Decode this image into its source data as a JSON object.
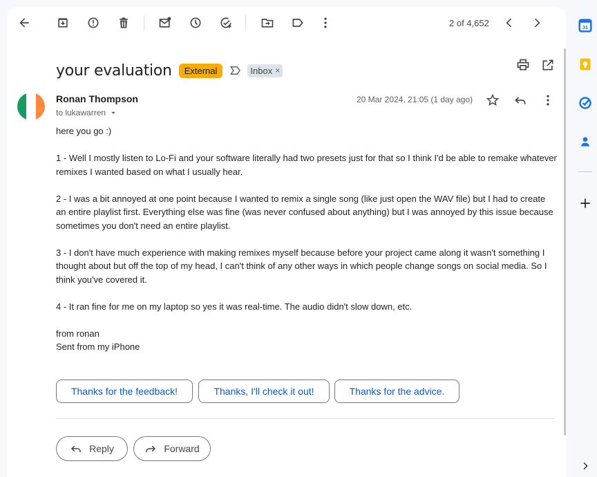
{
  "toolbar": {
    "back_icon": "arrow-left-icon",
    "archive_icon": "archive-icon",
    "spam_icon": "report-spam-icon",
    "delete_icon": "trash-icon",
    "mark_unread_icon": "mark-unread-icon",
    "snooze_icon": "clock-icon",
    "add_task_icon": "add-task-icon",
    "move_icon": "move-to-icon",
    "label_icon": "label-icon",
    "more_icon": "more-vert-icon",
    "pager": "2 of 4,652"
  },
  "email": {
    "subject": "your evaluation",
    "external_badge": "External",
    "inbox_label": "Inbox",
    "inbox_label_close": "×",
    "sender_name": "Ronan Thompson",
    "to_line": "to lukawarren",
    "date": "20 Mar 2024, 21:05 (1 day ago)",
    "avatar_colors": [
      "#169b62",
      "#ffffff",
      "#ff883e"
    ],
    "body": [
      "here you go :)",
      "1 - Well I mostly listen to Lo-Fi and your software literally had two presets just for that so I think I'd be able to remake whatever remixes I wanted based on what I usually hear.",
      "2 - I was a bit annoyed at one point because I wanted to remix a single song (like just open the WAV file) but I had to create an entire playlist first. Everything else was fine (was never confused about anything) but I was annoyed by this issue because sometimes you don't need an entire playlist.",
      "3 - I don't have much experience with making remixes myself because before your project came along it wasn't something I thought about but off the top of my head, I can't think of any other ways in which people change songs on social media. So I think you've covered it.",
      "4 - It ran fine for me on my laptop so yes it was real-time. The audio didn't slow down, etc.",
      "from ronan",
      "Sent from my iPhone"
    ]
  },
  "smart_replies": [
    "Thanks for the feedback!",
    "Thanks, I'll check it out!",
    "Thanks for the advice."
  ],
  "actions": {
    "reply": "Reply",
    "forward": "Forward"
  },
  "colors": {
    "accent": "#0b57d0",
    "external_badge": "#f9ab00",
    "calendar": "#1a73e8",
    "keep": "#fbbc04",
    "tasks": "#1a73e8"
  }
}
